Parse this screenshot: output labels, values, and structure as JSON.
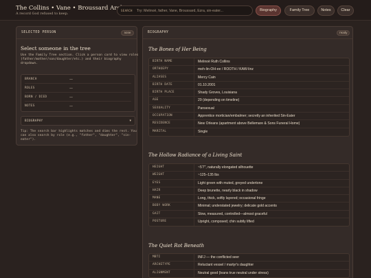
{
  "header": {
    "title": "The Collins • Vane • Broussard Archive",
    "subtitle": "A record God refused to keep.",
    "search_tag": "SEARCH",
    "search_placeholder": "Try: Melinoë, father, Vane, Broussard, Ezra, sin-eater...",
    "buttons": {
      "biography": "Biography",
      "family_tree": "Family Tree",
      "notes": "Notes",
      "clear": "Clear"
    },
    "active_button": "biography"
  },
  "left_panel": {
    "title": "SELECTED PERSON",
    "badge": "none",
    "heading": "Select someone in the tree",
    "description": "Use the Family Tree section. Click a person card to view roles (father/mother/son/daughter/etc.) and their biography dropdown.",
    "info": [
      {
        "label": "BRANCH",
        "value": "—"
      },
      {
        "label": "ROLES",
        "value": "—"
      },
      {
        "label": "BORN / DIED",
        "value": "—"
      },
      {
        "label": "NOTES",
        "value": "—"
      }
    ],
    "dropdown_label": "BIOGRAPHY",
    "tip": "Tip: The search bar highlights matches and dims the rest. You can also search by role (e.g., \"father\", \"daughter\", \"sin-eater\")."
  },
  "right_panel": {
    "title": "BIOGRAPHY",
    "badge": "ready",
    "sections": [
      {
        "title": "The Bones of Her Being",
        "rows": [
          {
            "label": "BIRTH NAME",
            "value": "Melinoë Ruth Collins"
          },
          {
            "label": "ORTHOEPY",
            "value": "meh-lin-OH-ee / ROOTH / KAW-linz"
          },
          {
            "label": "ALIASES",
            "value": "Mercy Cain"
          },
          {
            "label": "BIRTH DATE",
            "value": "01.10.2001"
          },
          {
            "label": "BIRTH PLACE",
            "value": "Shady Groves, Louisiana"
          },
          {
            "label": "AGE",
            "value": "29 (depending on timeline)"
          },
          {
            "label": "SEXUALITY",
            "value": "Pansexual"
          },
          {
            "label": "OCCUPATION",
            "value": "Apprentice mortician/embalmer; secretly an inherited Sin-Eater"
          },
          {
            "label": "RESIDENCE",
            "value": "New Orleans (apartment above Bellemare & Sons Funeral Home)"
          },
          {
            "label": "MARITAL",
            "value": "Single"
          }
        ]
      },
      {
        "title": "The Hollow Radiance of a Living Saint",
        "rows": [
          {
            "label": "HEIGHT",
            "value": "~5'7\", naturally elongated silhouette"
          },
          {
            "label": "WEIGHT",
            "value": "~125–135 lbs"
          },
          {
            "label": "EYES",
            "value": "Light green with muted, greyed undertone"
          },
          {
            "label": "HAIR",
            "value": "Deep brunette, nearly black in shadow"
          },
          {
            "label": "MANE",
            "value": "Long, thick, softly layered; occasional fringe"
          },
          {
            "label": "BODY WORK",
            "value": "Minimal; understated jewelry; delicate gold accents"
          },
          {
            "label": "GAIT",
            "value": "Slow, measured, controlled—almost graceful"
          },
          {
            "label": "POSTURE",
            "value": "Upright, composed; chin subtly lifted"
          }
        ]
      },
      {
        "title": "The Quiet Rot Beneath",
        "rows": [
          {
            "label": "MBTI",
            "value": "INFJ — the conflicted seer"
          },
          {
            "label": "ARCHETYPE",
            "value": "Reluctant vessel / martyr's daughter"
          },
          {
            "label": "ALIGNMENT",
            "value": "Neutral good (leans true neutral under stress)"
          }
        ]
      }
    ]
  },
  "colors": {
    "background": "#2a221f",
    "panel": "#342b28",
    "accent": "#5a3430",
    "text": "#e9dcc9"
  }
}
